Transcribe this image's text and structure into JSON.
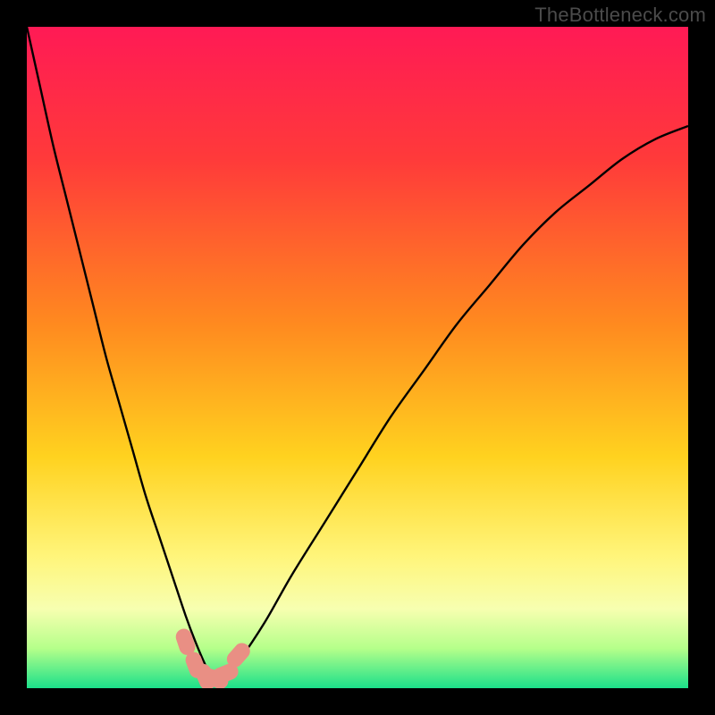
{
  "watermark": "TheBottleneck.com",
  "chart_data": {
    "type": "line",
    "title": "",
    "xlabel": "",
    "ylabel": "",
    "xlim": [
      0,
      100
    ],
    "ylim": [
      0,
      100
    ],
    "background_gradient": {
      "stops": [
        {
          "offset": 0,
          "color": "#ff1a55"
        },
        {
          "offset": 20,
          "color": "#ff3a3a"
        },
        {
          "offset": 45,
          "color": "#ff8a1f"
        },
        {
          "offset": 65,
          "color": "#ffd21f"
        },
        {
          "offset": 80,
          "color": "#fff57a"
        },
        {
          "offset": 88,
          "color": "#f7ffb0"
        },
        {
          "offset": 94,
          "color": "#b5ff8a"
        },
        {
          "offset": 100,
          "color": "#1be08a"
        }
      ]
    },
    "series": [
      {
        "name": "bottleneck-curve",
        "color": "#000000",
        "x": [
          0,
          2,
          4,
          6,
          8,
          10,
          12,
          14,
          16,
          18,
          20,
          22,
          24,
          25.5,
          27,
          28,
          29,
          30,
          32,
          36,
          40,
          45,
          50,
          55,
          60,
          65,
          70,
          75,
          80,
          85,
          90,
          95,
          100
        ],
        "y": [
          100,
          91,
          82,
          74,
          66,
          58,
          50,
          43,
          36,
          29,
          23,
          17,
          11,
          7,
          3.5,
          1.7,
          1.3,
          1.7,
          4,
          10,
          17,
          25,
          33,
          41,
          48,
          55,
          61,
          67,
          72,
          76,
          80,
          83,
          85
        ]
      }
    ],
    "markers": {
      "name": "bottom-cluster",
      "color": "#e98f84",
      "points": [
        {
          "x": 24.0,
          "y": 7.0
        },
        {
          "x": 25.5,
          "y": 3.5
        },
        {
          "x": 27.0,
          "y": 1.7
        },
        {
          "x": 28.5,
          "y": 1.4
        },
        {
          "x": 30.0,
          "y": 2.2
        },
        {
          "x": 32.0,
          "y": 5.0
        }
      ]
    }
  }
}
